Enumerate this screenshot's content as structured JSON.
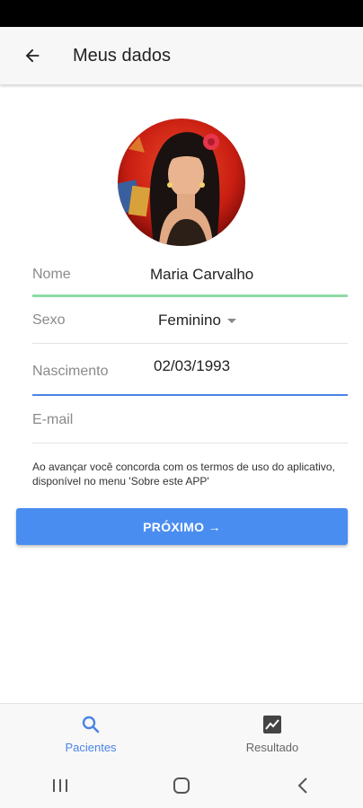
{
  "header": {
    "title": "Meus dados",
    "back_icon": "arrow-left-icon"
  },
  "profile": {
    "avatar_alt": ""
  },
  "form": {
    "name": {
      "label": "Nome",
      "value": "Maria Carvalho"
    },
    "sex": {
      "label": "Sexo",
      "value": "Feminino"
    },
    "birth": {
      "label": "Nascimento",
      "value": "02/03/1993"
    },
    "email": {
      "label": "E-mail",
      "value": ""
    }
  },
  "terms": "Ao avançar você concorda com os termos de uso do aplicativo, disponível no menu 'Sobre este APP'",
  "next_button": {
    "label": "PRÓXIMO →"
  },
  "bottom_nav": {
    "items": [
      {
        "label": "Pacientes",
        "icon": "search-icon",
        "active": true
      },
      {
        "label": "Resultado",
        "icon": "chart-icon",
        "active": false
      }
    ]
  },
  "system_nav": {
    "icons": [
      "recent-apps-icon",
      "home-icon",
      "back-icon"
    ]
  },
  "colors": {
    "accent": "#4a8df0",
    "name_underline": "#8fd9a6",
    "focus_underline": "#4a85e6"
  }
}
